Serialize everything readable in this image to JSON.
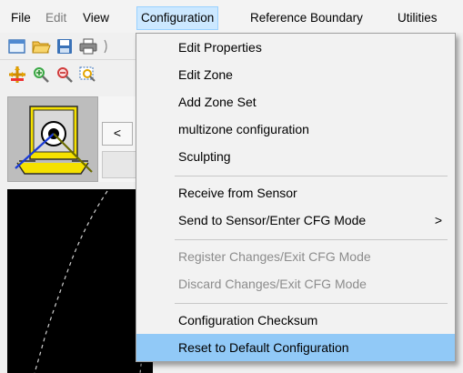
{
  "menubar": {
    "items": [
      {
        "label": "File",
        "state": "normal"
      },
      {
        "label": "Edit",
        "state": "disabled"
      },
      {
        "label": "View",
        "state": "normal"
      },
      {
        "label": "Configuration",
        "state": "active"
      },
      {
        "label": "Reference Boundary",
        "state": "normal"
      },
      {
        "label": "Utilities",
        "state": "normal"
      }
    ]
  },
  "configuration_menu": {
    "items": [
      {
        "label": "Edit Properties",
        "enabled": true
      },
      {
        "label": "Edit Zone",
        "enabled": true
      },
      {
        "label": "Add Zone Set",
        "enabled": true
      },
      {
        "label": "multizone configuration",
        "enabled": true
      },
      {
        "label": "Sculpting",
        "enabled": true
      },
      {
        "label": "Receive from Sensor",
        "enabled": true
      },
      {
        "label": "Send to Sensor/Enter CFG Mode",
        "enabled": true,
        "submenu_arrow": ">"
      },
      {
        "label": "Register Changes/Exit CFG Mode",
        "enabled": false
      },
      {
        "label": "Discard Changes/Exit CFG Mode",
        "enabled": false
      },
      {
        "label": "Configuration Checksum",
        "enabled": true
      },
      {
        "label": "Reset to Default Configuration",
        "enabled": true,
        "highlighted": true
      }
    ]
  },
  "navigator": {
    "prev_label": "<"
  },
  "colors": {
    "menu_active_bg": "#cce8ff",
    "menu_highlight": "#91c9f7",
    "sensor_yellow": "#f5e100",
    "canvas_bg": "#000000"
  },
  "icons": [
    "new-file-icon",
    "open-folder-icon",
    "save-icon",
    "print-icon",
    "move-tool-icon",
    "zoom-in-icon",
    "zoom-out-icon",
    "zoom-window-icon",
    "sensor-icon"
  ]
}
